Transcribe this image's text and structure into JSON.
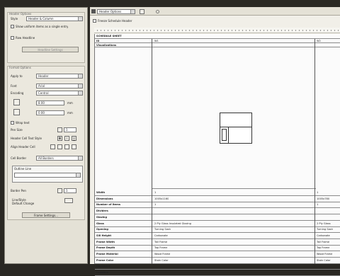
{
  "left_panel": {
    "group1_title": "Header Options",
    "style_label": "Style",
    "style_value": "Header & Column",
    "show_all_label": "Show uniform items as a single entry",
    "row_headline_label": "Row Headline",
    "headline_button": "Headline Settings",
    "format_title": "Format Options",
    "apply_to_label": "Apply to",
    "apply_to_value": "Header",
    "font_label": "Font",
    "font_value": "Arial",
    "encoding_label": "Encoding",
    "encoding_value": "Central",
    "value1": "8.00",
    "unit1": "mm",
    "value2": "0.00",
    "unit2": "mm",
    "wrap_label": "Wrap text",
    "pen_label": "Pen Size",
    "pen_value": "1",
    "align_label": "Header Cell Text Style",
    "bold_glyph": "B",
    "italic_glyph": "I",
    "underline_glyph": "U",
    "align_cell_label": "Align Header Cell",
    "cell_border_label": "Cell Border",
    "cell_border_value": "All Borders",
    "combo_label": "Outline Line",
    "combo_value": "",
    "border_pen_label": "Border Pen",
    "border_pen_value": "1",
    "line_style_label": "Line/Style",
    "line_style_value": "Default Change",
    "frame_button": "Frame Settings..."
  },
  "toolbar": {
    "dropdown_value": "Header Options",
    "icon1": "search-icon",
    "icon2": "gear-icon"
  },
  "subbar": {
    "freeze_label": "Freeze Schedule Header"
  },
  "sheet": {
    "title_header": "SCHEDULE SHEET",
    "id_label": "ID",
    "id_value1": "W1",
    "id_value2": "W2",
    "elevation_label": "Visualizations",
    "detail_rows": [
      {
        "label": "Width",
        "v1": "1",
        "v2": "1"
      },
      {
        "label": "Dimensions",
        "v1": "1005x1160",
        "v2": "1005x780"
      },
      {
        "label": "Number of Items",
        "v1": "1",
        "v2": "1"
      },
      {
        "label": "Dividers",
        "v1": "",
        "v2": ""
      },
      {
        "label": "Glazing",
        "v1": "",
        "v2": ""
      },
      {
        "label": "Glass",
        "v1": "2 Ply Glass Insulated Glazing",
        "v2": "2 Ply Glass"
      },
      {
        "label": "Opening",
        "v1": "Turning Sash",
        "v2": "Turning Sash"
      },
      {
        "label": "Sill Height",
        "v1": "Carbonate",
        "v2": "Carbonate"
      },
      {
        "label": "Frame Width",
        "v1": "Tall Frame",
        "v2": "Tall Frame"
      },
      {
        "label": "Frame Depth",
        "v1": "Top Frame",
        "v2": "Top Frame"
      },
      {
        "label": "Frame Material",
        "v1": "Wood Frame",
        "v2": "Wood Frame"
      },
      {
        "label": "Frame Color",
        "v1": "Stain Color",
        "v2": "Stain Color"
      },
      {
        "label": "Hardware",
        "v1": "",
        "v2": ""
      },
      {
        "label": "Location",
        "v1": "",
        "v2": ""
      }
    ]
  }
}
